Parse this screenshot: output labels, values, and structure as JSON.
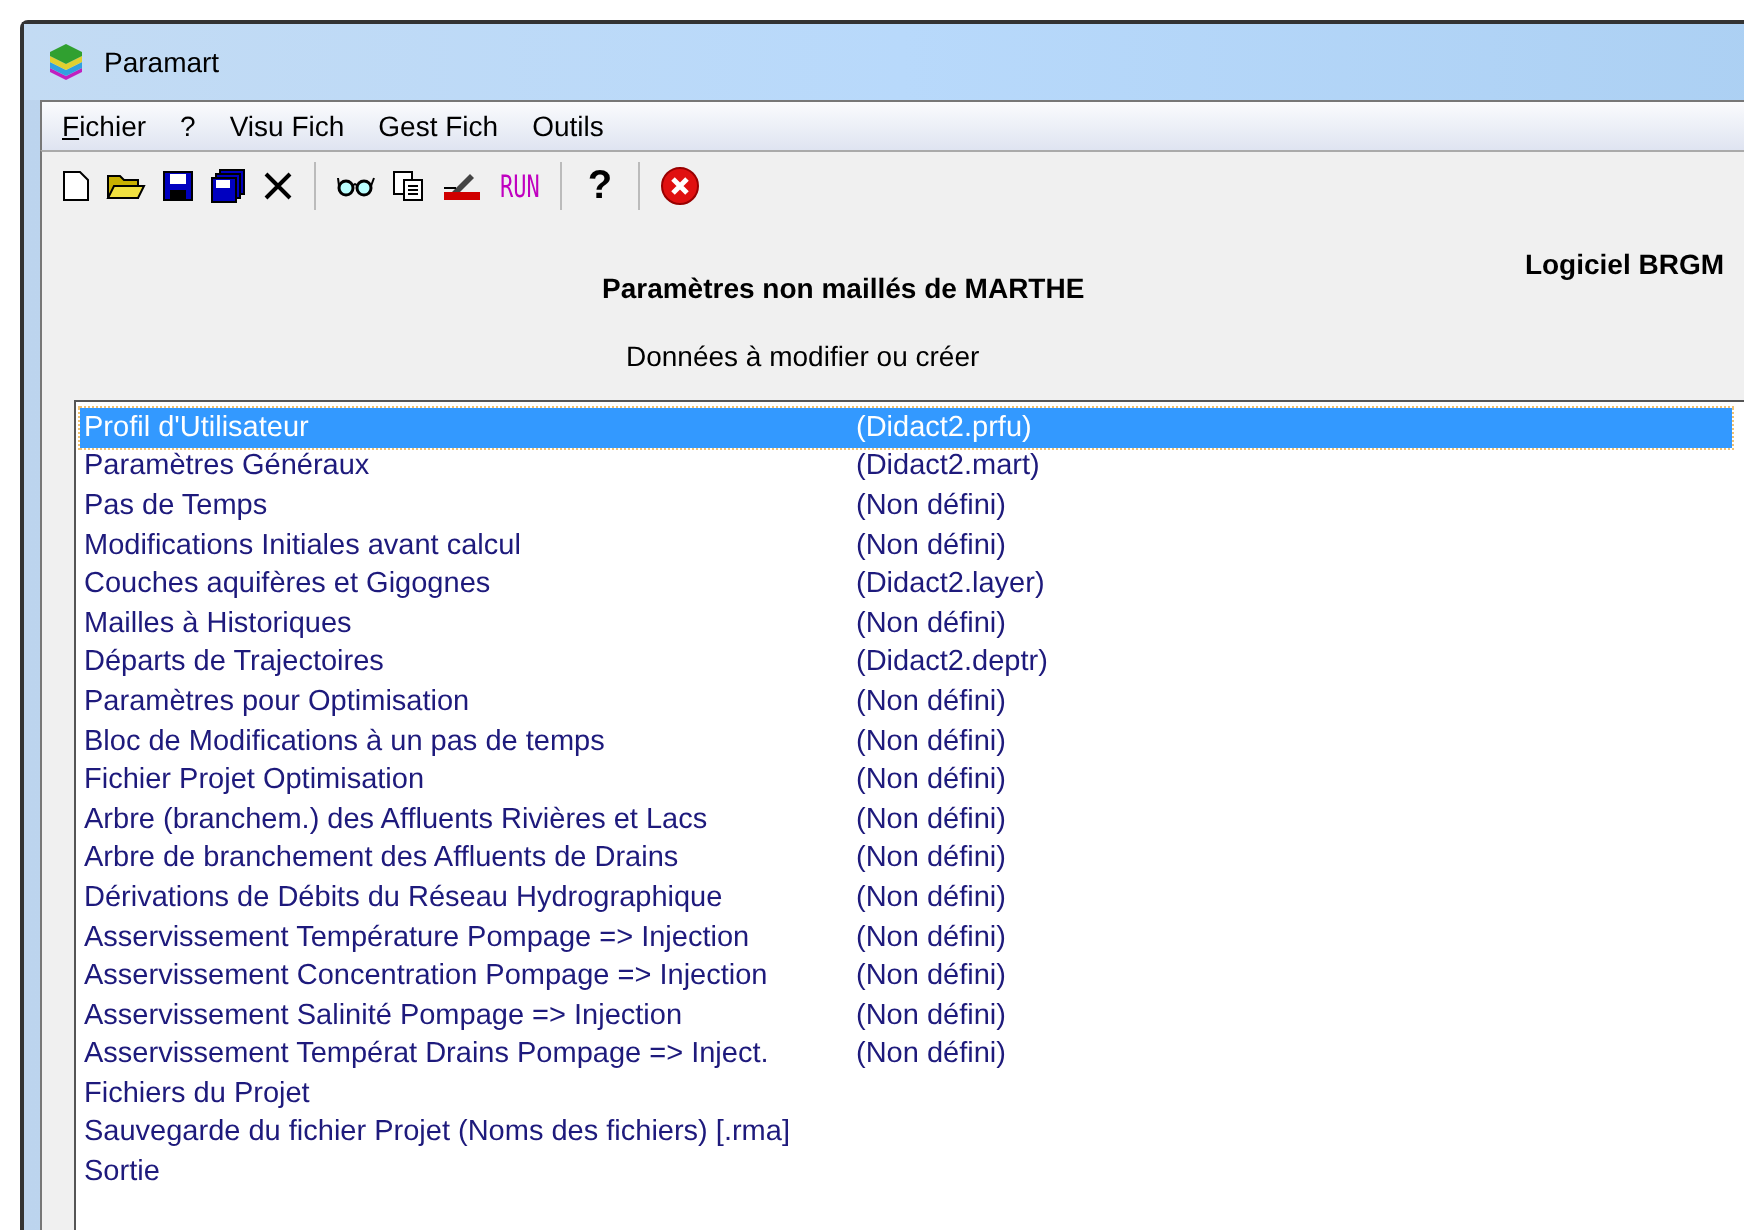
{
  "window": {
    "title": "Paramart"
  },
  "menu": [
    {
      "label": "Fichier",
      "mnemonic": true
    },
    {
      "label": "?",
      "mnemonic": false
    },
    {
      "label": "Visu Fich",
      "mnemonic": false
    },
    {
      "label": "Gest Fich",
      "mnemonic": false
    },
    {
      "label": "Outils",
      "mnemonic": false
    }
  ],
  "toolbar": {
    "run_label": "RUN",
    "help_label": "?"
  },
  "header": {
    "title": "Paramètres non maillés de MARTHE",
    "brand": "Logiciel BRGM",
    "subtitle": "Données à modifier ou créer"
  },
  "items": [
    {
      "name": "Profil d'Utilisateur",
      "file": "(Didact2.prfu)",
      "selected": true
    },
    {
      "name": "Paramètres Généraux",
      "file": "(Didact2.mart)",
      "selected": false
    },
    {
      "name": "Pas de Temps",
      "file": "(Non défini)",
      "selected": false
    },
    {
      "name": "Modifications Initiales avant calcul",
      "file": "(Non défini)",
      "selected": false
    },
    {
      "name": "Couches aquifères et Gigognes",
      "file": "(Didact2.layer)",
      "selected": false
    },
    {
      "name": "Mailles à Historiques",
      "file": "(Non défini)",
      "selected": false
    },
    {
      "name": "Départs de Trajectoires",
      "file": "(Didact2.deptr)",
      "selected": false
    },
    {
      "name": "Paramètres pour Optimisation",
      "file": "(Non défini)",
      "selected": false
    },
    {
      "name": "Bloc de Modifications à un pas de temps",
      "file": "(Non défini)",
      "selected": false
    },
    {
      "name": "Fichier Projet Optimisation",
      "file": "(Non défini)",
      "selected": false
    },
    {
      "name": "Arbre (branchem.) des Affluents Rivières et Lacs",
      "file": "(Non défini)",
      "selected": false
    },
    {
      "name": "Arbre de branchement des Affluents de Drains",
      "file": "(Non défini)",
      "selected": false
    },
    {
      "name": "Dérivations de Débits du Réseau Hydrographique",
      "file": "(Non défini)",
      "selected": false
    },
    {
      "name": "Asservissement Température Pompage => Injection",
      "file": "(Non défini)",
      "selected": false
    },
    {
      "name": "Asservissement Concentration Pompage => Injection",
      "file": "(Non défini)",
      "selected": false
    },
    {
      "name": "Asservissement Salinité Pompage => Injection",
      "file": "(Non défini)",
      "selected": false
    },
    {
      "name": "Asservissement Températ Drains Pompage => Inject.",
      "file": "(Non défini)",
      "selected": false
    },
    {
      "name": "Fichiers du Projet",
      "selected": false
    },
    {
      "name": "Sauvegarde du fichier Projet (Noms des fichiers) [.rma]",
      "selected": false
    },
    {
      "name": "Sortie",
      "selected": false
    }
  ]
}
